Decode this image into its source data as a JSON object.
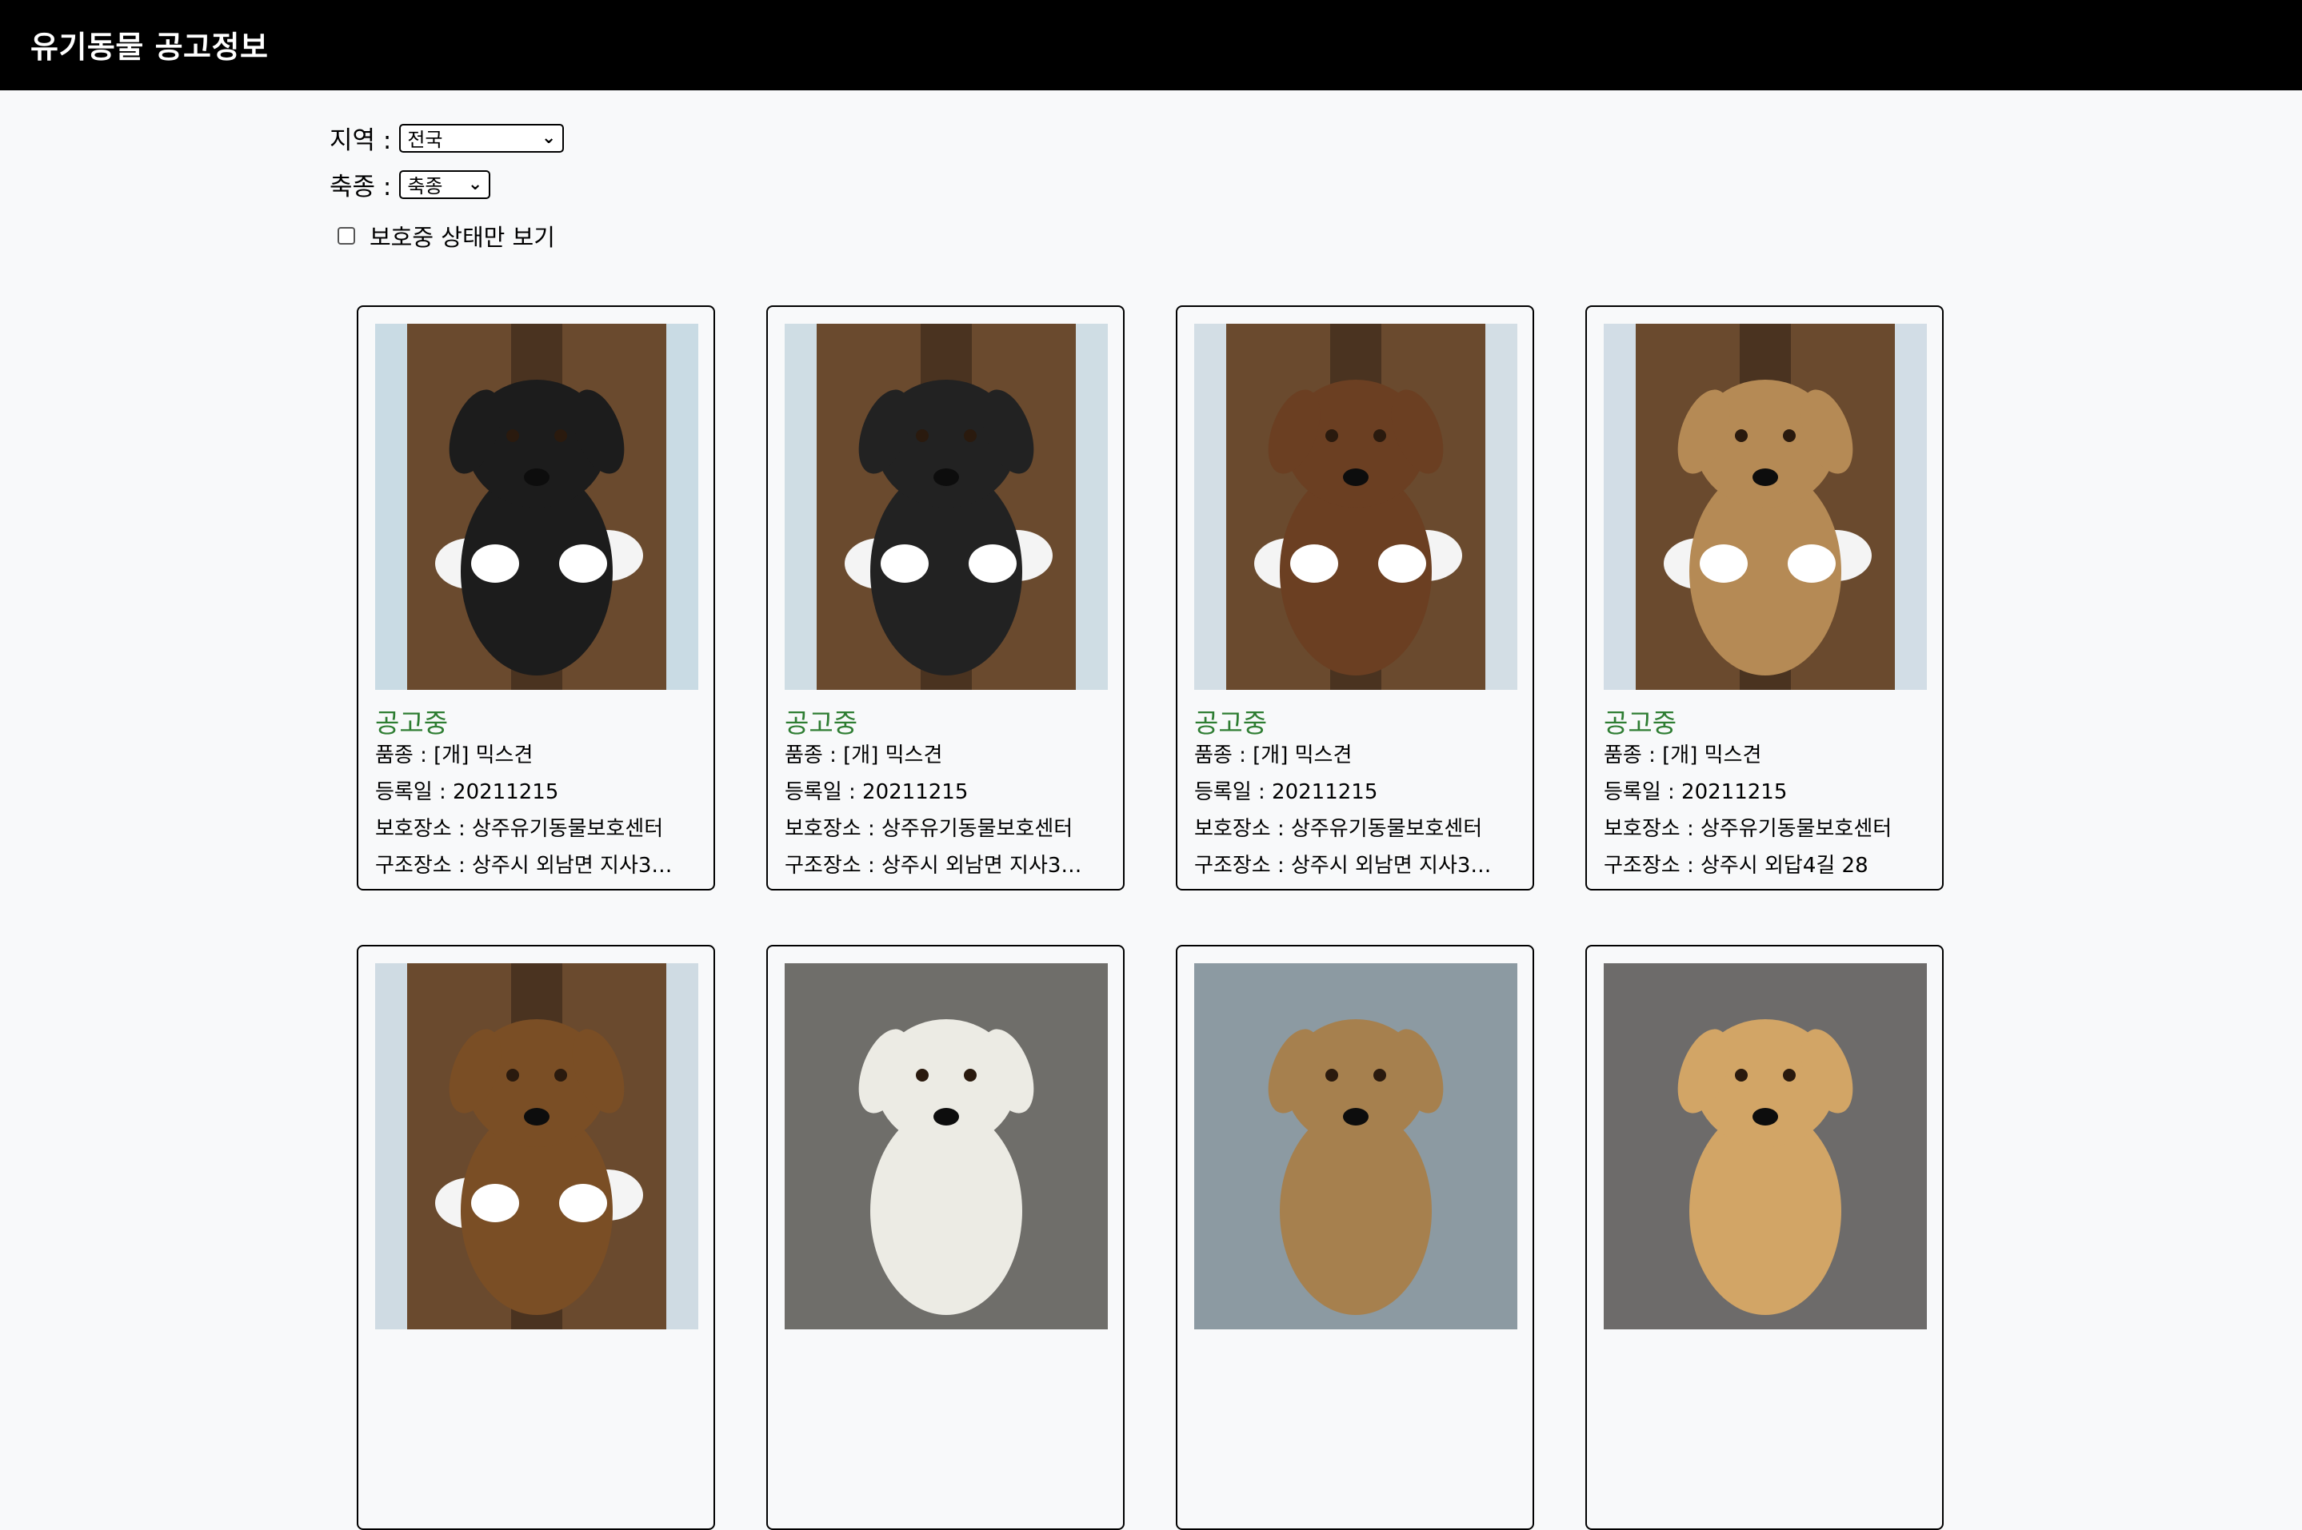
{
  "header": {
    "title": "유기동물 공고정보"
  },
  "filters": {
    "region_label": "지역 :",
    "region_selected": "전국",
    "species_label": "축종 :",
    "species_selected": "축종",
    "protect_only_label": "보호중 상태만 보기",
    "protect_only_checked": false
  },
  "cards": [
    {
      "status": "공고중",
      "breed": "품종 : [개] 믹스견",
      "date": "등록일 : 20211215",
      "shelter": "보호장소 : 상주유기동물보호센터",
      "found": "구조장소 : 상주시 외남면 지사3길 ...",
      "dog_color": "#1c1c1c",
      "bg_color": "#c9dbe4"
    },
    {
      "status": "공고중",
      "breed": "품종 : [개] 믹스견",
      "date": "등록일 : 20211215",
      "shelter": "보호장소 : 상주유기동물보호센터",
      "found": "구조장소 : 상주시 외남면 지사3길 ...",
      "dog_color": "#222222",
      "bg_color": "#cfdde4"
    },
    {
      "status": "공고중",
      "breed": "품종 : [개] 믹스견",
      "date": "등록일 : 20211215",
      "shelter": "보호장소 : 상주유기동물보호센터",
      "found": "구조장소 : 상주시 외남면 지사3길 ...",
      "dog_color": "#6b3f22",
      "bg_color": "#d3dee5"
    },
    {
      "status": "공고중",
      "breed": "품종 : [개] 믹스견",
      "date": "등록일 : 20211215",
      "shelter": "보호장소 : 상주유기동물보호센터",
      "found": "구조장소 : 상주시 외답4길 28",
      "dog_color": "#b58a55",
      "bg_color": "#d2dde6"
    },
    {
      "status": "",
      "breed": "",
      "date": "",
      "shelter": "",
      "found": "",
      "dog_color": "#7a4e25",
      "bg_color": "#cfdbe3"
    },
    {
      "status": "",
      "breed": "",
      "date": "",
      "shelter": "",
      "found": "",
      "dog_color": "#ecebe4",
      "bg_color": "#6f6e6a"
    },
    {
      "status": "",
      "breed": "",
      "date": "",
      "shelter": "",
      "found": "",
      "dog_color": "#a6804e",
      "bg_color": "#8c9aa2"
    },
    {
      "status": "",
      "breed": "",
      "date": "",
      "shelter": "",
      "found": "",
      "dog_color": "#d2a566",
      "bg_color": "#6d6b6a"
    }
  ],
  "icons": {
    "select_chevron": "chevron-down-icon"
  }
}
